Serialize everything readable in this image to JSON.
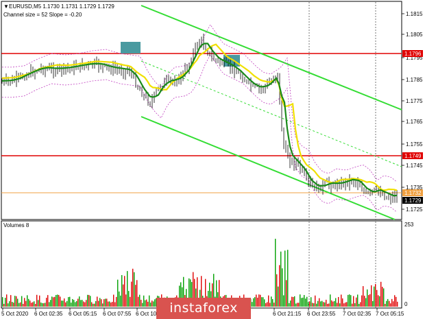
{
  "header": {
    "symbol_line": "EURUSD,M5  1.1730 1.1731 1.1729 1.1729",
    "indicator_line": "Channel size = 52 Slope = -0.20"
  },
  "volume_panel": {
    "label": "Volumes 8",
    "scale_top": "253",
    "scale_bottom": "0"
  },
  "price_levels": [
    {
      "label": "1.1796",
      "color": "#e00000"
    },
    {
      "label": "1.1749",
      "color": "#e00000"
    },
    {
      "label": "1.1732",
      "color": "#f0a040"
    },
    {
      "label": "1.1729",
      "color": "#000000"
    }
  ],
  "price_axis": [
    "1.1815",
    "1.1805",
    "1.1795",
    "1.1785",
    "1.1775",
    "1.1765",
    "1.1755",
    "1.1745",
    "1.1735",
    "1.1725"
  ],
  "time_axis": [
    "5 Oct 2020",
    "6 Oct 02:35",
    "6 Oct 05:15",
    "6 Oct 07:55",
    "6 Oct 10:35",
    "6 Oct 21:15",
    "6 Oct 23:55",
    "7 Oct 02:35",
    "7 Oct 05:15"
  ],
  "watermark": "instaforex",
  "colors": {
    "candles": "#000000",
    "ma_green": "#1a8a1a",
    "ma_yellow": "#f0e000",
    "channel": "#33dd33",
    "level_red": "#e00000",
    "volume_up": "#00a000",
    "volume_down": "#e00000",
    "marker": "#4a9aa0"
  }
}
